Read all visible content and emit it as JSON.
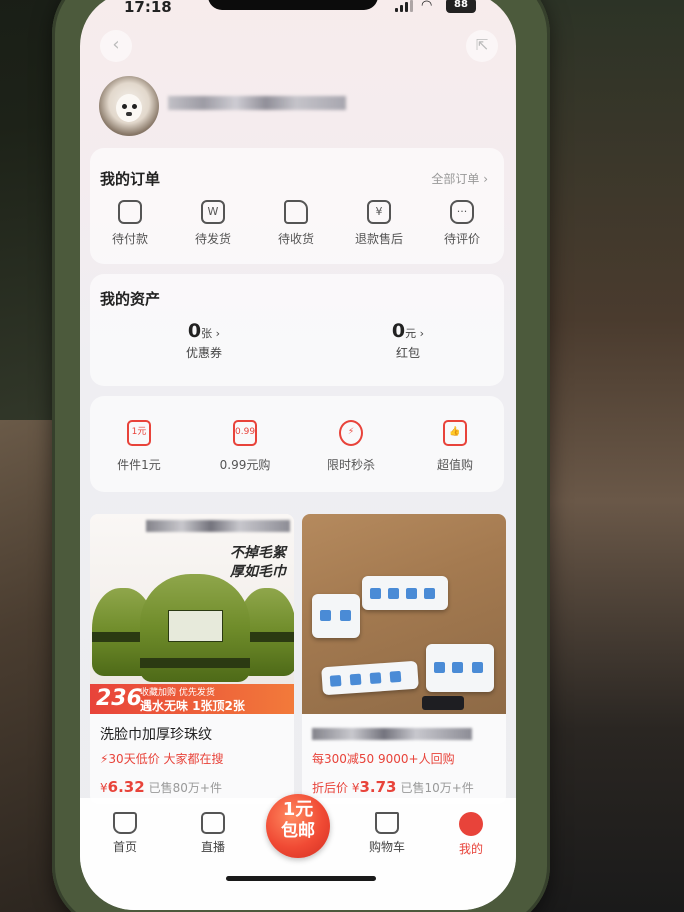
{
  "status": {
    "time": "17:18",
    "battery": "88"
  },
  "header": {
    "back_icon": "chevron-left-icon",
    "share_icon": "share-icon"
  },
  "orders": {
    "title": "我的订单",
    "view_all": "全部订单 ›",
    "items": [
      {
        "label": "待付款",
        "icon": "wallet-icon"
      },
      {
        "label": "待发货",
        "icon": "package-icon"
      },
      {
        "label": "待收货",
        "icon": "truck-icon"
      },
      {
        "label": "退款售后",
        "icon": "refund-icon",
        "glyph": "¥"
      },
      {
        "label": "待评价",
        "icon": "comment-icon",
        "glyph": "···"
      }
    ]
  },
  "assets": {
    "title": "我的资产",
    "coupons": {
      "value": "0",
      "unit": "张 ›",
      "label": "优惠券"
    },
    "redpacket": {
      "value": "0",
      "unit": "元 ›",
      "label": "红包"
    }
  },
  "promos": [
    {
      "label": "件件1元",
      "icon_text": "1元"
    },
    {
      "label": "0.99元购",
      "icon_text": "0.99"
    },
    {
      "label": "限时秒杀",
      "icon_text": "⚡"
    },
    {
      "label": "超值购",
      "icon_text": "👍"
    }
  ],
  "products": [
    {
      "slogan_1": "不掉毛絮",
      "slogan_2": "厚如毛巾",
      "badge_num": "236",
      "badge_top": "收藏加购 优先发货",
      "badge_text": "遇水无味 1张顶2张",
      "title": "洗脸巾加厚珍珠纹",
      "tag": "⚡30天低价  大家都在搜",
      "price_prefix": "¥",
      "price": "6.32",
      "sold": "已售80万+件"
    },
    {
      "tag": "每300减50  9000+人回购",
      "price_prefix": "折后价 ¥",
      "price": "3.73",
      "sold": "已售10万+件"
    }
  ],
  "tabbar": {
    "home": "首页",
    "live": "直播",
    "center_1": "1元",
    "center_2": "包邮",
    "cart": "购物车",
    "me": "我的"
  },
  "colors": {
    "accent": "#e8433a",
    "text": "#222222",
    "muted": "#999999"
  }
}
